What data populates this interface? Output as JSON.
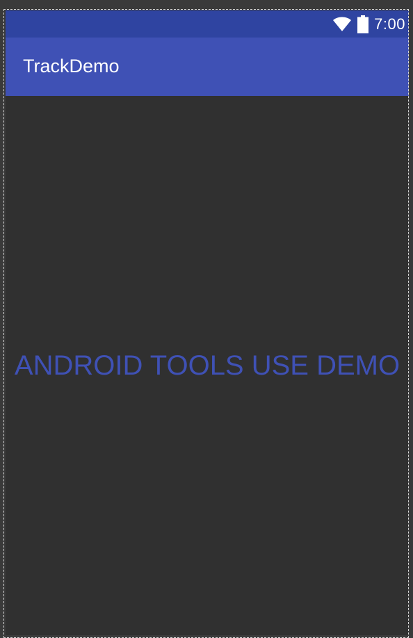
{
  "status_bar": {
    "time": "7:00",
    "wifi_icon": "wifi-icon",
    "battery_icon": "battery-icon",
    "color": "#2f44a1"
  },
  "app_bar": {
    "title": "TrackDemo",
    "color": "#3f51b5"
  },
  "content": {
    "text": "ANDROID TOOLS USE DEMO",
    "text_color": "#3f51b5",
    "background": "#303030"
  }
}
